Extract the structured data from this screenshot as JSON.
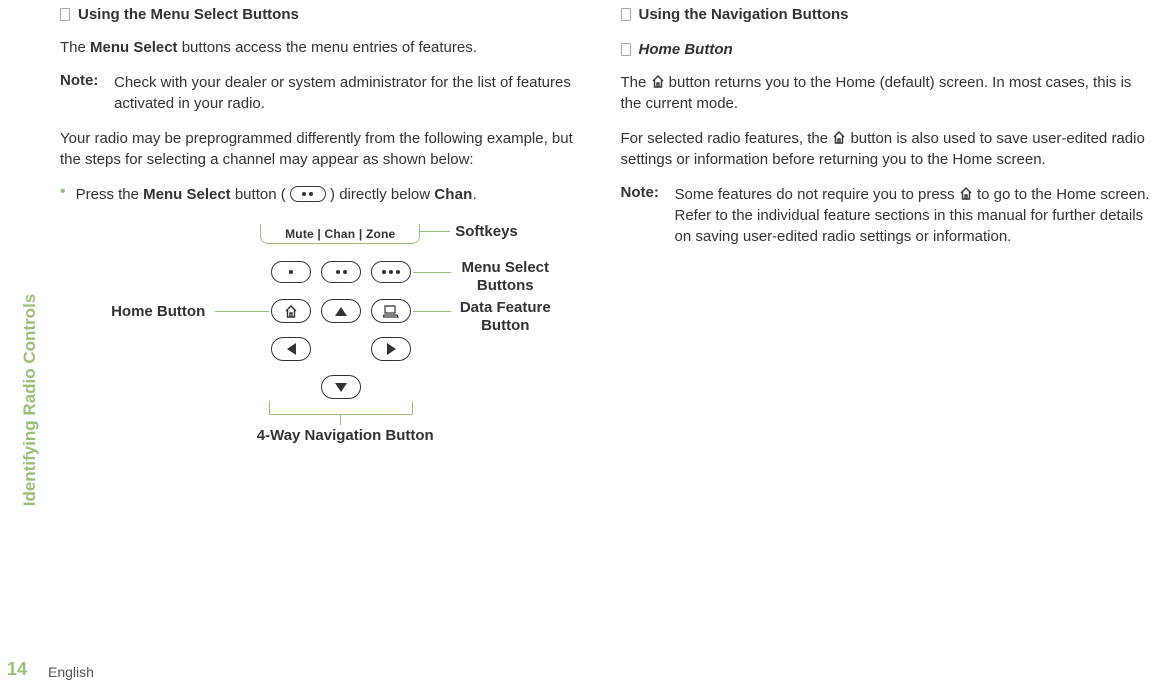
{
  "side": {
    "section": "Identifying Radio Controls",
    "page": "14",
    "lang": "English"
  },
  "left": {
    "h1": "Using the Menu Select Buttons",
    "p1a": "The ",
    "p1b": "Menu Select",
    "p1c": " buttons access the menu entries of features.",
    "note_label": "Note:",
    "note_body": "Check with your dealer or system administrator for the list of features activated in your radio.",
    "p2": "Your radio may be preprogrammed differently from the following example, but the steps for selecting a channel may appear as shown below:",
    "bullet_a": "Press the ",
    "bullet_b": "Menu Select",
    "bullet_c": " button ( ",
    "bullet_d": " ) directly below ",
    "bullet_e": "Chan",
    "bullet_f": "."
  },
  "diagram": {
    "softkeys_text": "Mute | Chan | Zone",
    "softkeys_label": "Softkeys",
    "menu_select_label_1": "Menu Select",
    "menu_select_label_2": "Buttons",
    "home_label": "Home Button",
    "data_label_1": "Data Feature",
    "data_label_2": "Button",
    "nav_label": "4-Way Navigation Button"
  },
  "right": {
    "h1": "Using the Navigation Buttons",
    "h2": "Home Button",
    "p1a": "The ",
    "p1b": " button returns you to the Home (default) screen. In most cases, this is the current mode.",
    "p2a": "For selected radio features, the ",
    "p2b": " button is also used to save user-edited radio settings or information before returning you to the Home screen.",
    "note_label": "Note:",
    "note_a": "Some features do not require you to press ",
    "note_b": " to go to the Home screen. Refer to the individual feature sections in this manual for further details on saving user-edited radio settings or information."
  }
}
